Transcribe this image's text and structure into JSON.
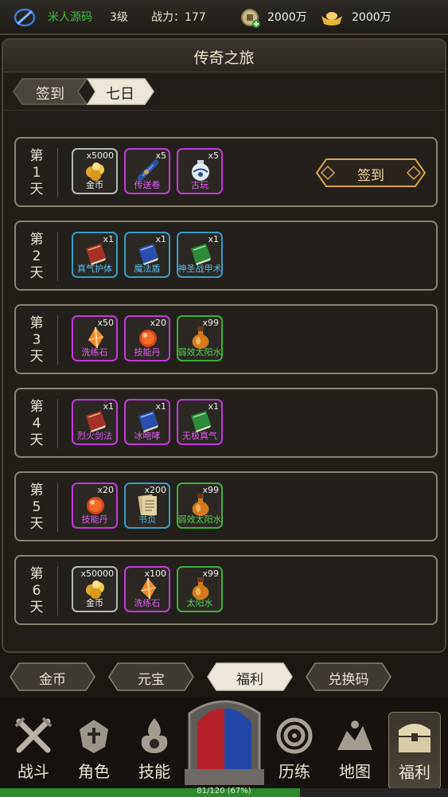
{
  "topbar": {
    "name": "米人源码",
    "level": "3级",
    "power": "战力：177",
    "coins": "2000万",
    "ingots": "2000万"
  },
  "panel": {
    "title": "传奇之旅",
    "tabs": [
      {
        "label": "签到",
        "active": false
      },
      {
        "label": "七日",
        "active": true
      }
    ]
  },
  "days": [
    {
      "label": [
        "第",
        "1",
        "天"
      ],
      "items": [
        {
          "name": "金币",
          "qty": "x5000",
          "rarity": "grey",
          "icon": "gold-coin-icon"
        },
        {
          "name": "传送卷",
          "qty": "x5",
          "rarity": "purple",
          "icon": "scroll-icon"
        },
        {
          "name": "古玩",
          "qty": "x5",
          "rarity": "purple",
          "icon": "vase-icon"
        }
      ],
      "button": "签到"
    },
    {
      "label": [
        "第",
        "2",
        "天"
      ],
      "items": [
        {
          "name": "真气护体",
          "qty": "x1",
          "rarity": "blue",
          "icon": "red-book-icon"
        },
        {
          "name": "魔法盾",
          "qty": "x1",
          "rarity": "blue",
          "icon": "blue-book-icon"
        },
        {
          "name": "神圣战甲术",
          "qty": "x1",
          "rarity": "blue",
          "icon": "green-book-icon"
        }
      ]
    },
    {
      "label": [
        "第",
        "3",
        "天"
      ],
      "items": [
        {
          "name": "洗练石",
          "qty": "x50",
          "rarity": "purple",
          "icon": "crystal-icon"
        },
        {
          "name": "技能丹",
          "qty": "x20",
          "rarity": "purple",
          "icon": "red-orb-icon"
        },
        {
          "name": "弱效太阳水",
          "qty": "x99",
          "rarity": "green",
          "icon": "potion-icon"
        }
      ]
    },
    {
      "label": [
        "第",
        "4",
        "天"
      ],
      "items": [
        {
          "name": "烈火剑法",
          "qty": "x1",
          "rarity": "purple",
          "icon": "red-book-icon"
        },
        {
          "name": "冰咆哮",
          "qty": "x1",
          "rarity": "purple",
          "icon": "blue-book-icon"
        },
        {
          "name": "无极真气",
          "qty": "x1",
          "rarity": "purple",
          "icon": "green-book-icon"
        }
      ]
    },
    {
      "label": [
        "第",
        "5",
        "天"
      ],
      "items": [
        {
          "name": "技能丹",
          "qty": "x20",
          "rarity": "purple",
          "icon": "red-orb-icon"
        },
        {
          "name": "书页",
          "qty": "x200",
          "rarity": "blue",
          "icon": "page-icon"
        },
        {
          "name": "弱效太阳水",
          "qty": "x99",
          "rarity": "green",
          "icon": "potion-icon"
        }
      ]
    },
    {
      "label": [
        "第",
        "6",
        "天"
      ],
      "items": [
        {
          "name": "金币",
          "qty": "x50000",
          "rarity": "grey",
          "icon": "gold-coin-icon"
        },
        {
          "name": "洗练石",
          "qty": "x100",
          "rarity": "purple",
          "icon": "crystal-icon"
        },
        {
          "name": "太阳水",
          "qty": "x99",
          "rarity": "green",
          "icon": "potion-icon"
        }
      ]
    }
  ],
  "shop_tabs": [
    {
      "label": "金币",
      "active": false
    },
    {
      "label": "元宝",
      "active": false
    },
    {
      "label": "福利",
      "active": true
    },
    {
      "label": "兑换码",
      "active": false
    }
  ],
  "nav": [
    {
      "label": "战斗",
      "icon": "crossed-swords-icon"
    },
    {
      "label": "角色",
      "icon": "helmet-icon"
    },
    {
      "label": "技能",
      "icon": "flame-icon"
    },
    {
      "label": "",
      "icon": "portal-gate-icon"
    },
    {
      "label": "历练",
      "icon": "vortex-icon"
    },
    {
      "label": "地图",
      "icon": "map-icon"
    },
    {
      "label": "福利",
      "icon": "treasure-chest-icon",
      "active": true
    }
  ],
  "xp": {
    "text": "81/120 (67%)",
    "fraction": 0.67
  },
  "colors": {
    "purple": "#c03ad6",
    "blue": "#3a9bc4",
    "green": "#3eae3c",
    "grey": "#b8b8b8",
    "gold": "#e0b45a"
  }
}
